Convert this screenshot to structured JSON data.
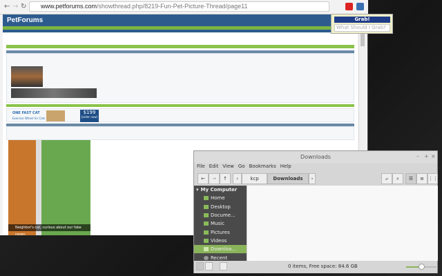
{
  "browser": {
    "url_domain": "www.petforums.com",
    "url_path": "/showthread.php/8219-Fun-Pet-Picture-Thread/page11"
  },
  "extension": {
    "grab_button": "Grab!",
    "input_placeholder": "What Should I Grab?"
  },
  "forum": {
    "logo": "PetForums",
    "caption": "Neighbor's cat, curious about our fake raven.",
    "ad_brand": "ONE FAST CAT",
    "ad_tagline": "Exercise Wheel for Cats",
    "ad_price": "$199",
    "ad_order": "[order now]"
  },
  "file_manager": {
    "title": "Downloads",
    "menu": [
      "File",
      "Edit",
      "View",
      "Go",
      "Bookmarks",
      "Help"
    ],
    "path": [
      "kcp",
      "Downloads"
    ],
    "sidebar_header": "My Computer",
    "sidebar_items": [
      "Home",
      "Desktop",
      "Docume...",
      "Music",
      "Pictures",
      "Videos",
      "Downloa...",
      "Recent"
    ],
    "status": "0 items, Free space: 84.6 GB",
    "zoom_level": 0.5
  }
}
